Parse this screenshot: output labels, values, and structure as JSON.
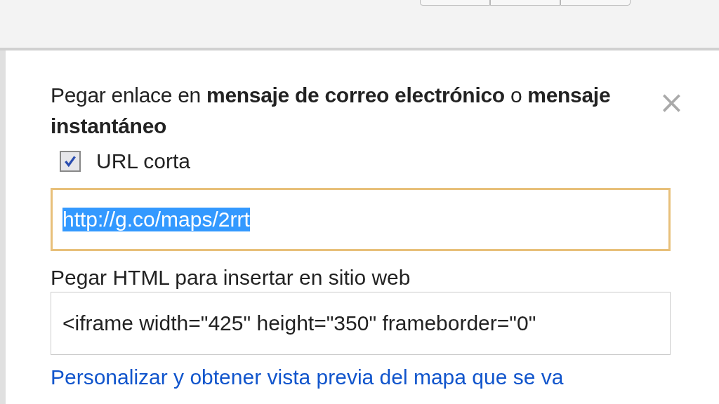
{
  "dialog": {
    "heading": "Pegar enlace en **mensaje de correo electrónico** o **mensaje instantáneo**",
    "close": "×",
    "short_url": {
      "label": "URL corta",
      "checked": true
    },
    "link_field": {
      "value": "http://g.co/maps/2rrt",
      "selected": true
    },
    "embed_label": "Pegar HTML para insertar en sitio web",
    "embed_field": {
      "value": "<iframe width=\"425\" height=\"350\" frameborder=\"0\""
    },
    "customize_link": "Personalizar y obtener vista previa del mapa que se va"
  }
}
